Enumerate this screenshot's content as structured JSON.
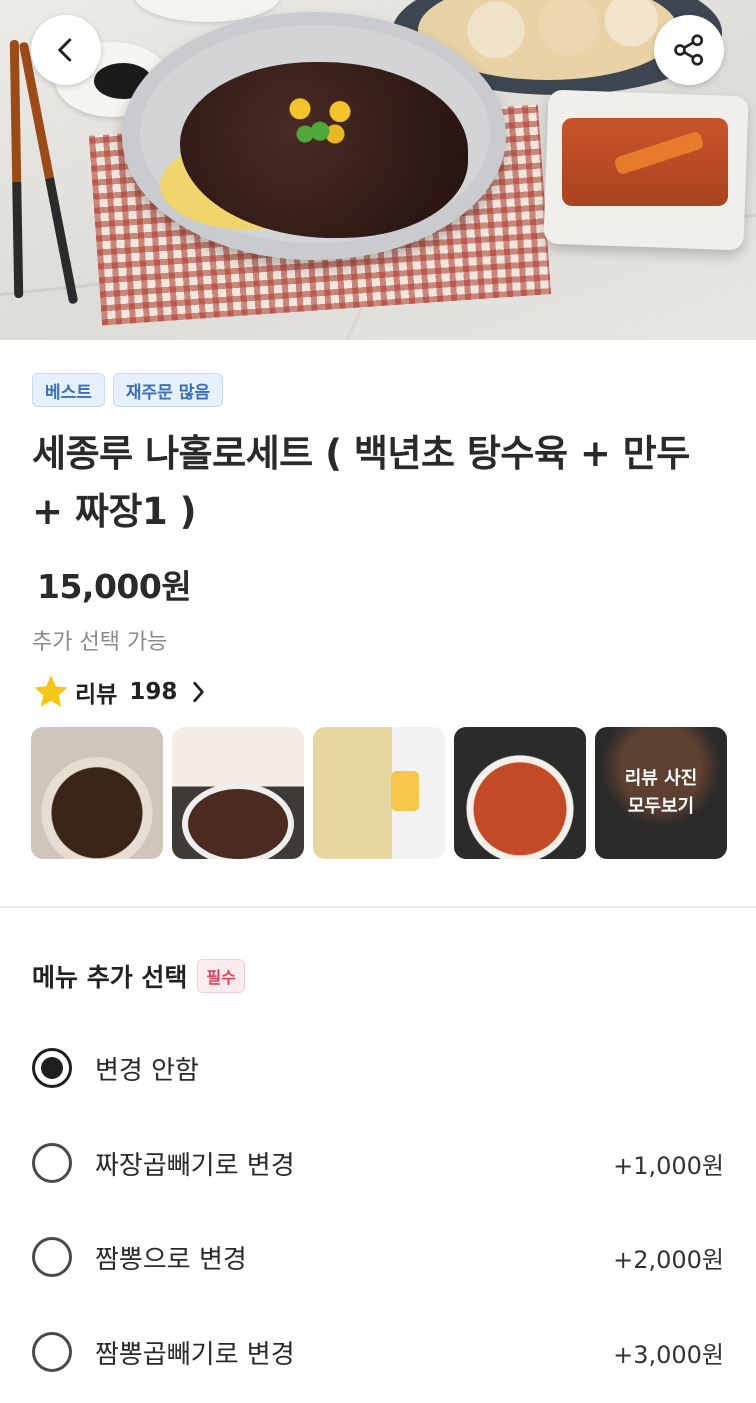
{
  "header": {
    "back_icon": "chevron-left-icon",
    "share_icon": "share-icon"
  },
  "product": {
    "badges": [
      "베스트",
      "재주문 많음"
    ],
    "title": "세종루 나홀로세트 ( 백년초 탕수육 + 만두 + 짜장1 )",
    "price": "15,000원",
    "extra_note": "추가 선택 가능",
    "review_label": "리뷰",
    "review_count": "198"
  },
  "photos": {
    "view_all_line1": "리뷰 사진",
    "view_all_line2": "모두보기"
  },
  "options": {
    "section_title": "메뉴 추가 선택",
    "required_badge": "필수",
    "items": [
      {
        "label": "변경 안함",
        "price": "",
        "selected": true
      },
      {
        "label": "짜장곱빼기로 변경",
        "price": "+1,000원",
        "selected": false
      },
      {
        "label": "짬뽕으로 변경",
        "price": "+2,000원",
        "selected": false
      },
      {
        "label": "짬뽕곱빼기로 변경",
        "price": "+3,000원",
        "selected": false
      }
    ]
  },
  "colors": {
    "badge_blue": "#3a70b8",
    "required_red": "#e2425c",
    "star_yellow": "#f5c518"
  }
}
